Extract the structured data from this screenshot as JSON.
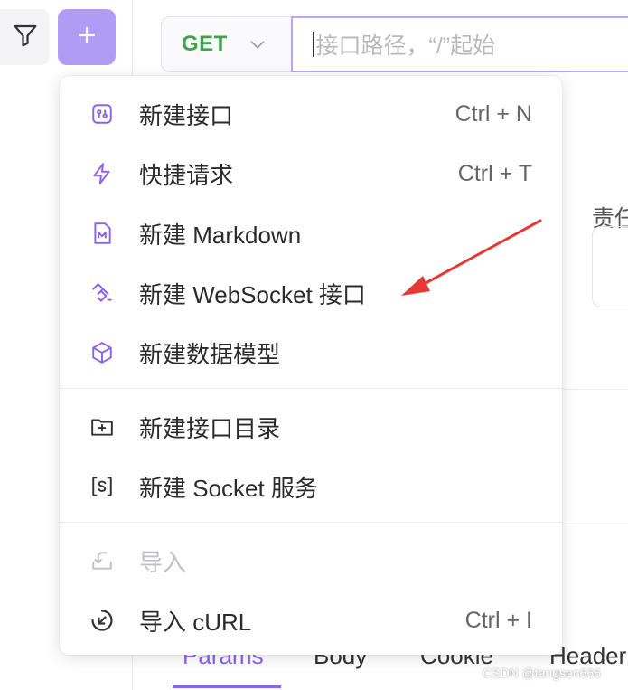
{
  "toolbar": {
    "filter_icon": "filter-icon",
    "add_icon": "plus-icon",
    "add_color": "#b19cf5"
  },
  "request": {
    "method": "GET",
    "method_color": "#3fa34d",
    "path_placeholder": "接口路径，“/”起始"
  },
  "side_panel": {
    "owner_label": "责任"
  },
  "tabs": [
    {
      "label": "Params",
      "active": true
    },
    {
      "label": "Body",
      "active": false
    },
    {
      "label": "Cookie",
      "active": false
    },
    {
      "label": "Header",
      "active": false
    }
  ],
  "menu": {
    "items": [
      {
        "label": "新建接口",
        "shortcut": "Ctrl + N",
        "icon": "api-icon",
        "disabled": false
      },
      {
        "label": "快捷请求",
        "shortcut": "Ctrl + T",
        "icon": "lightning-icon",
        "disabled": false
      },
      {
        "label": "新建 Markdown",
        "shortcut": "",
        "icon": "markdown-icon",
        "disabled": false
      },
      {
        "label": "新建 WebSocket 接口",
        "shortcut": "",
        "icon": "websocket-icon",
        "disabled": false
      },
      {
        "label": "新建数据模型",
        "shortcut": "",
        "icon": "cube-icon",
        "disabled": false
      },
      {
        "label": "新建接口目录",
        "shortcut": "",
        "icon": "folder-plus-icon",
        "disabled": false
      },
      {
        "label": "新建 Socket 服务",
        "shortcut": "",
        "icon": "socket-icon",
        "disabled": false
      },
      {
        "label": "导入",
        "shortcut": "",
        "icon": "import-icon",
        "disabled": true
      },
      {
        "label": "导入 cURL",
        "shortcut": "Ctrl + I",
        "icon": "curl-import-icon",
        "disabled": false
      }
    ]
  },
  "annotation": {
    "arrow_color": "#e53935"
  },
  "watermark": "CSDN @tangsen666"
}
